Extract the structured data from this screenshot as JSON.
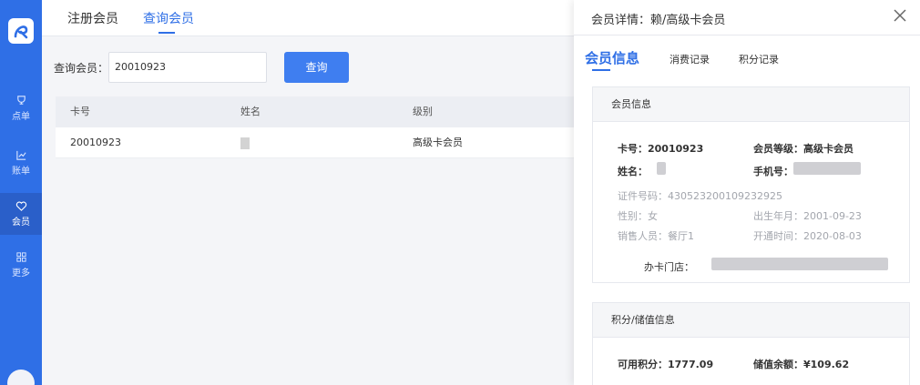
{
  "top_tabs": [
    "注册会员",
    "查询会员"
  ],
  "sidebar": [
    {
      "label": "点单",
      "icon": "trophy-icon"
    },
    {
      "label": "账单",
      "icon": "chart-icon"
    },
    {
      "label": "会员",
      "icon": "heart-icon"
    },
    {
      "label": "更多",
      "icon": "grid-icon"
    }
  ],
  "query": {
    "label": "查询会员：",
    "value": "20010923",
    "button": "查询"
  },
  "table": {
    "headers": [
      "卡号",
      "姓名",
      "级别"
    ],
    "rows": [
      {
        "card": "20010923",
        "level": "高级卡会员"
      }
    ]
  },
  "panel": {
    "title": "会员详情：赖/高级卡会员",
    "tabs": [
      "会员信息",
      "消费记录",
      "积分记录"
    ],
    "member_card": {
      "header": "会员信息",
      "card_no": "卡号：20010923",
      "level": "会员等级：高级卡会员",
      "name_label": "姓名：",
      "phone_label": "手机号：",
      "id_no": "证件号码：430523200109232925",
      "gender": "性别：女",
      "birth": "出生年月：2001-09-23",
      "sales": "销售人员：餐厅1",
      "open_time": "开通时间：2020-08-03",
      "store_label": "办卡门店："
    },
    "points_card": {
      "header": "积分/储值信息",
      "points": "可用积分：1777.09",
      "balance": "储值余额：¥109.62"
    }
  }
}
